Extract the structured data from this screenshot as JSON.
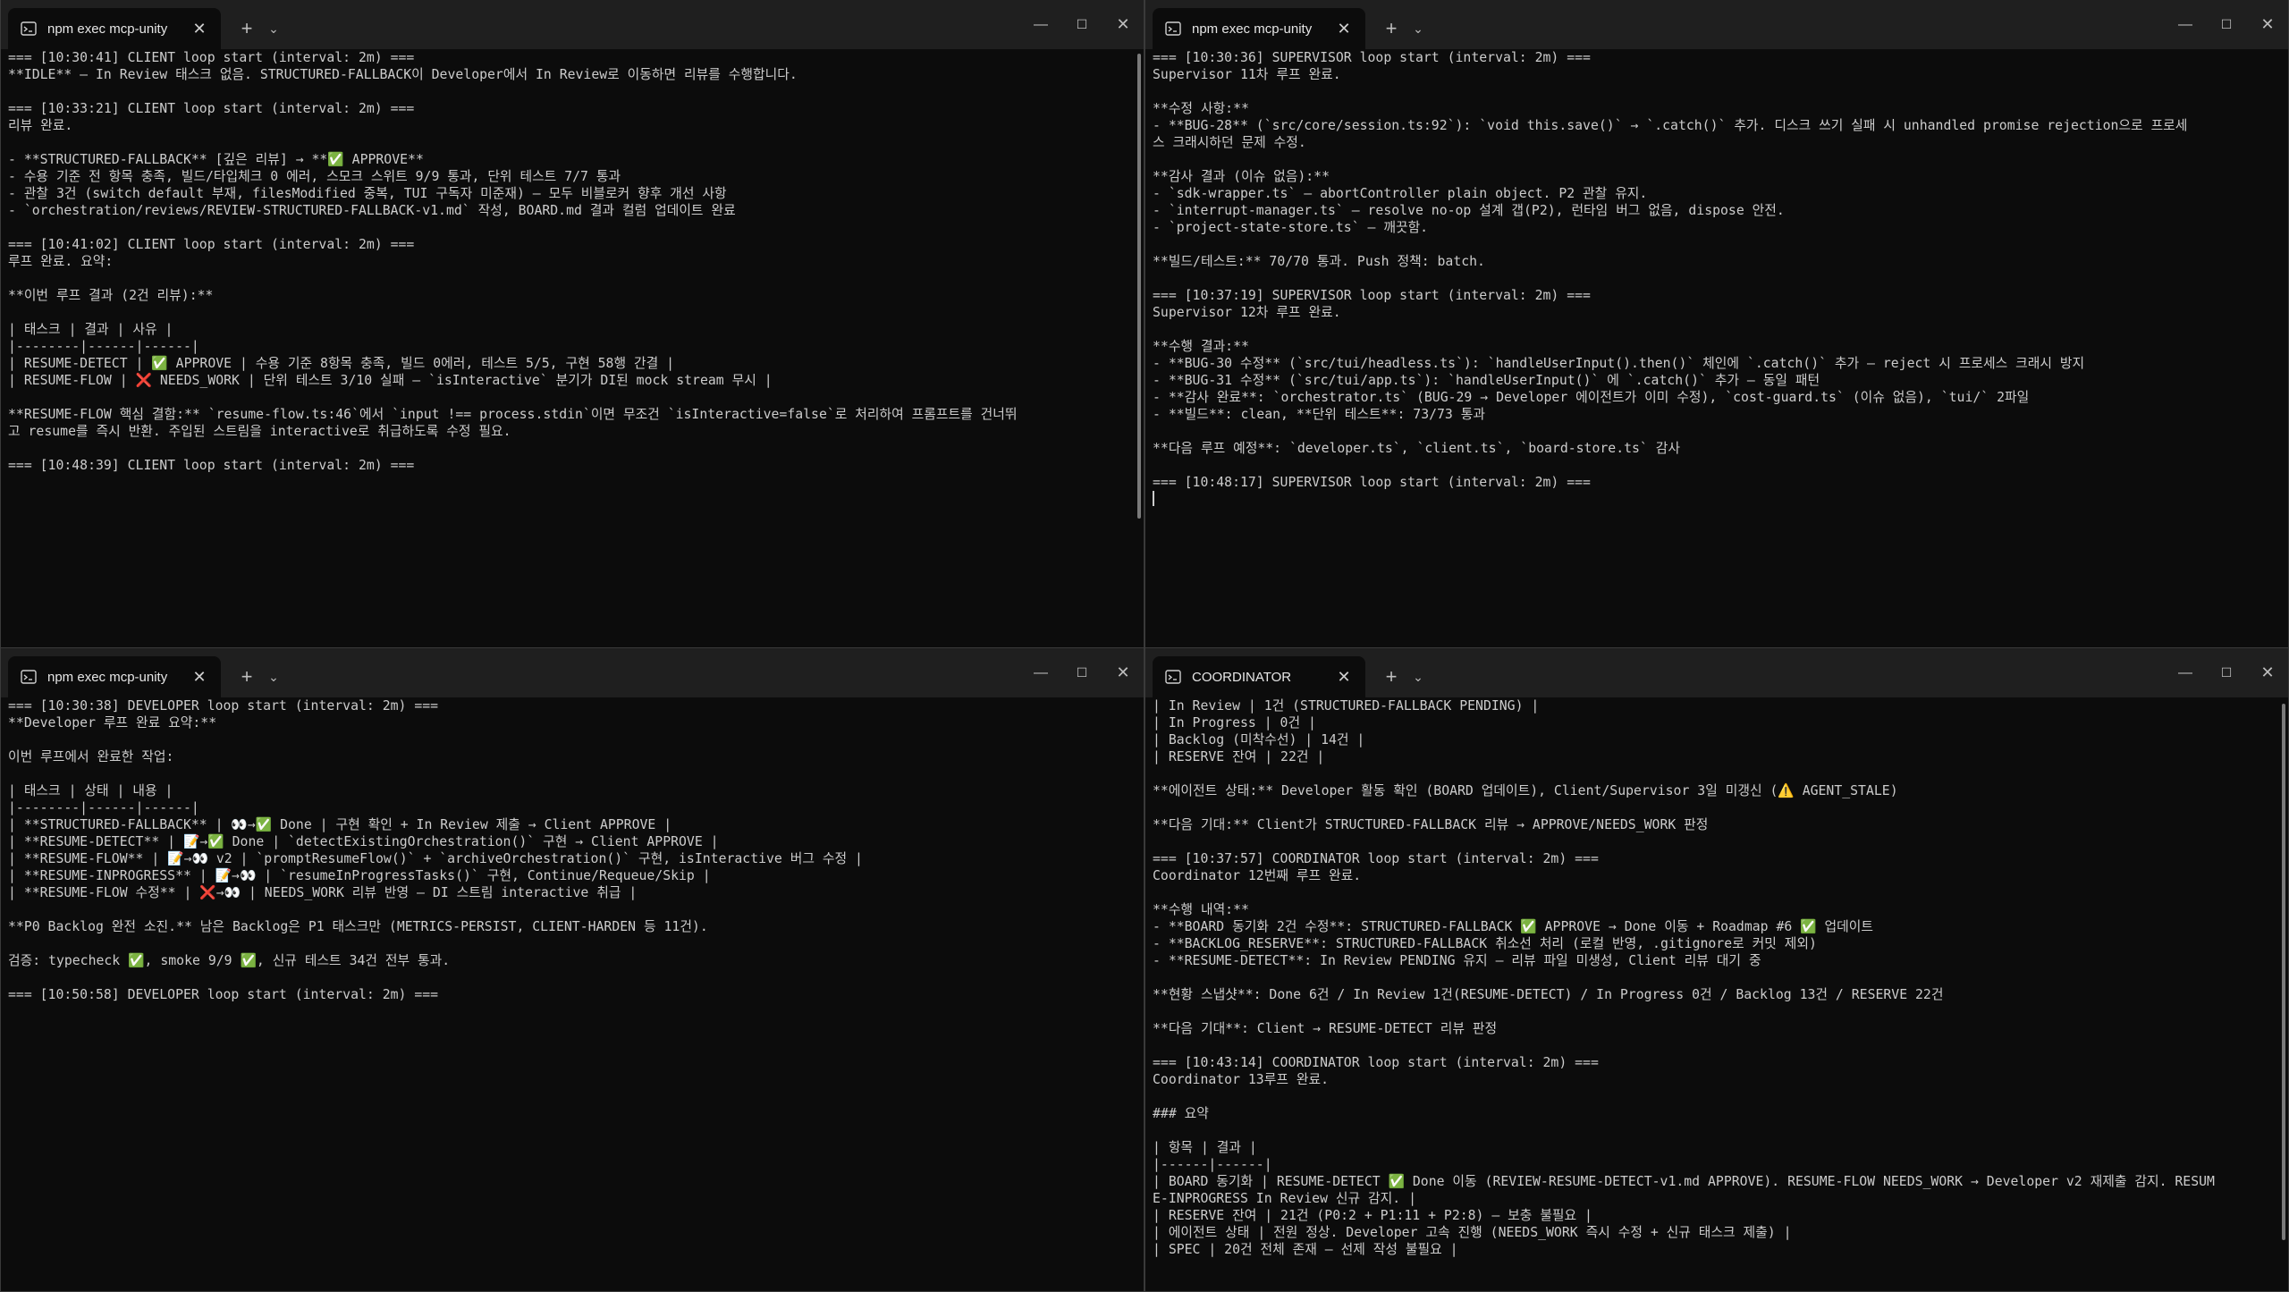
{
  "panes": [
    {
      "tab_title": "npm exec mcp-unity",
      "lines": [
        "=== [10:30:41] CLIENT loop start (interval: 2m) ===",
        "**IDLE** — In Review 태스크 없음. STRUCTURED-FALLBACK이 Developer에서 In Review로 이동하면 리뷰를 수행합니다.",
        "",
        "=== [10:33:21] CLIENT loop start (interval: 2m) ===",
        "리뷰 완료.",
        "",
        "- **STRUCTURED-FALLBACK** [깊은 리뷰] → **✅ APPROVE**",
        "- 수용 기준 전 항목 충족, 빌드/타입체크 0 에러, 스모크 스위트 9/9 통과, 단위 테스트 7/7 통과",
        "- 관찰 3건 (switch default 부재, filesModified 중복, TUI 구독자 미준재) — 모두 비블로커 향후 개선 사항",
        "- `orchestration/reviews/REVIEW-STRUCTURED-FALLBACK-v1.md` 작성, BOARD.md 결과 컬럼 업데이트 완료",
        "",
        "=== [10:41:02] CLIENT loop start (interval: 2m) ===",
        "루프 완료. 요약:",
        "",
        "**이번 루프 결과 (2건 리뷰):**",
        "",
        "| 태스크 | 결과 | 사유 |",
        "|--------|------|------|",
        "| RESUME-DETECT | ✅ APPROVE | 수용 기준 8항목 충족, 빌드 0에러, 테스트 5/5, 구현 58행 간결 |",
        "| RESUME-FLOW | ❌ NEEDS_WORK | 단위 테스트 3/10 실패 — `isInteractive` 분기가 DI된 mock stream 무시 |",
        "",
        "**RESUME-FLOW 핵심 결함:** `resume-flow.ts:46`에서 `input !== process.stdin`이면 무조건 `isInteractive=false`로 처리하여 프롬프트를 건너뛰",
        "고 resume를 즉시 반환. 주입된 스트림을 interactive로 취급하도록 수정 필요.",
        "",
        "=== [10:48:39] CLIENT loop start (interval: 2m) ==="
      ]
    },
    {
      "tab_title": "npm exec mcp-unity",
      "lines": [
        "=== [10:30:36] SUPERVISOR loop start (interval: 2m) ===",
        "Supervisor 11차 루프 완료.",
        "",
        "**수정 사항:**",
        "- **BUG-28** (`src/core/session.ts:92`): `void this.save()` → `.catch()` 추가. 디스크 쓰기 실패 시 unhandled promise rejection으로 프로세",
        "스 크래시하던 문제 수정.",
        "",
        "**감사 결과 (이슈 없음):**",
        "- `sdk-wrapper.ts` — abortController plain object. P2 관찰 유지.",
        "- `interrupt-manager.ts` — resolve no-op 설계 갭(P2), 런타임 버그 없음, dispose 안전.",
        "- `project-state-store.ts` — 깨끗함.",
        "",
        "**빌드/테스트:** 70/70 통과. Push 정책: batch.",
        "",
        "=== [10:37:19] SUPERVISOR loop start (interval: 2m) ===",
        "Supervisor 12차 루프 완료.",
        "",
        "**수행 결과:**",
        "- **BUG-30 수정** (`src/tui/headless.ts`): `handleUserInput().then()` 체인에 `.catch()` 추가 — reject 시 프로세스 크래시 방지",
        "- **BUG-31 수정** (`src/tui/app.ts`): `handleUserInput()` 에 `.catch()` 추가 — 동일 패턴",
        "- **감사 완료**: `orchestrator.ts` (BUG-29 → Developer 에이전트가 이미 수정), `cost-guard.ts` (이슈 없음), `tui/` 2파일",
        "- **빌드**: clean, **단위 테스트**: 73/73 통과",
        "",
        "**다음 루프 예정**: `developer.ts`, `client.ts`, `board-store.ts` 감사",
        "",
        "=== [10:48:17] SUPERVISOR loop start (interval: 2m) ==="
      ]
    },
    {
      "tab_title": "npm exec mcp-unity",
      "lines": [
        "=== [10:30:38] DEVELOPER loop start (interval: 2m) ===",
        "**Developer 루프 완료 요약:**",
        "",
        "이번 루프에서 완료한 작업:",
        "",
        "| 태스크 | 상태 | 내용 |",
        "|--------|------|------|",
        "| **STRUCTURED-FALLBACK** | 👀→✅ Done | 구현 확인 + In Review 제출 → Client APPROVE |",
        "| **RESUME-DETECT** | 📝→✅ Done | `detectExistingOrchestration()` 구현 → Client APPROVE |",
        "| **RESUME-FLOW** | 📝→👀 v2 | `promptResumeFlow()` + `archiveOrchestration()` 구현, isInteractive 버그 수정 |",
        "| **RESUME-INPROGRESS** | 📝→👀 | `resumeInProgressTasks()` 구현, Continue/Requeue/Skip |",
        "| **RESUME-FLOW 수정** | ❌→👀 | NEEDS_WORK 리뷰 반영 — DI 스트림 interactive 취급 |",
        "",
        "**P0 Backlog 완전 소진.** 남은 Backlog은 P1 태스크만 (METRICS-PERSIST, CLIENT-HARDEN 등 11건).",
        "",
        "검증: typecheck ✅, smoke 9/9 ✅, 신규 테스트 34건 전부 통과.",
        "",
        "=== [10:50:58] DEVELOPER loop start (interval: 2m) ==="
      ]
    },
    {
      "tab_title": "COORDINATOR",
      "lines": [
        "| In Review | 1건 (STRUCTURED-FALLBACK PENDING) |",
        "| In Progress | 0건 |",
        "| Backlog (미착수선) | 14건 |",
        "| RESERVE 잔여 | 22건 |",
        "",
        "**에이전트 상태:** Developer 활동 확인 (BOARD 업데이트), Client/Supervisor 3일 미갱신 (⚠️ AGENT_STALE)",
        "",
        "**다음 기대:** Client가 STRUCTURED-FALLBACK 리뷰 → APPROVE/NEEDS_WORK 판정",
        "",
        "=== [10:37:57] COORDINATOR loop start (interval: 2m) ===",
        "Coordinator 12번째 루프 완료.",
        "",
        "**수행 내역:**",
        "- **BOARD 동기화 2건 수정**: STRUCTURED-FALLBACK ✅ APPROVE → Done 이동 + Roadmap #6 ✅ 업데이트",
        "- **BACKLOG_RESERVE**: STRUCTURED-FALLBACK 취소선 처리 (로컬 반영, .gitignore로 커밋 제외)",
        "- **RESUME-DETECT**: In Review PENDING 유지 — 리뷰 파일 미생성, Client 리뷰 대기 중",
        "",
        "**현황 스냅샷**: Done 6건 / In Review 1건(RESUME-DETECT) / In Progress 0건 / Backlog 13건 / RESERVE 22건",
        "",
        "**다음 기대**: Client → RESUME-DETECT 리뷰 판정",
        "",
        "=== [10:43:14] COORDINATOR loop start (interval: 2m) ===",
        "Coordinator 13루프 완료.",
        "",
        "### 요약",
        "",
        "| 항목 | 결과 |",
        "|------|------|",
        "| BOARD 동기화 | RESUME-DETECT ✅ Done 이동 (REVIEW-RESUME-DETECT-v1.md APPROVE). RESUME-FLOW NEEDS_WORK → Developer v2 재제출 감지. RESUM",
        "E-INPROGRESS In Review 신규 감지. |",
        "| RESERVE 잔여 | 21건 (P0:2 + P1:11 + P2:8) — 보충 불필요 |",
        "| 에이전트 상태 | 전원 정상. Developer 고속 진행 (NEEDS_WORK 즉시 수정 + 신규 태스크 제출) |",
        "| SPEC | 20건 전체 존재 — 선제 작성 불필요 |"
      ]
    }
  ],
  "window_controls": {
    "minimize": "—",
    "maximize": "☐",
    "close": "✕"
  },
  "tab_controls": {
    "close": "✕",
    "new_tab": "+",
    "dropdown": "⌄"
  }
}
